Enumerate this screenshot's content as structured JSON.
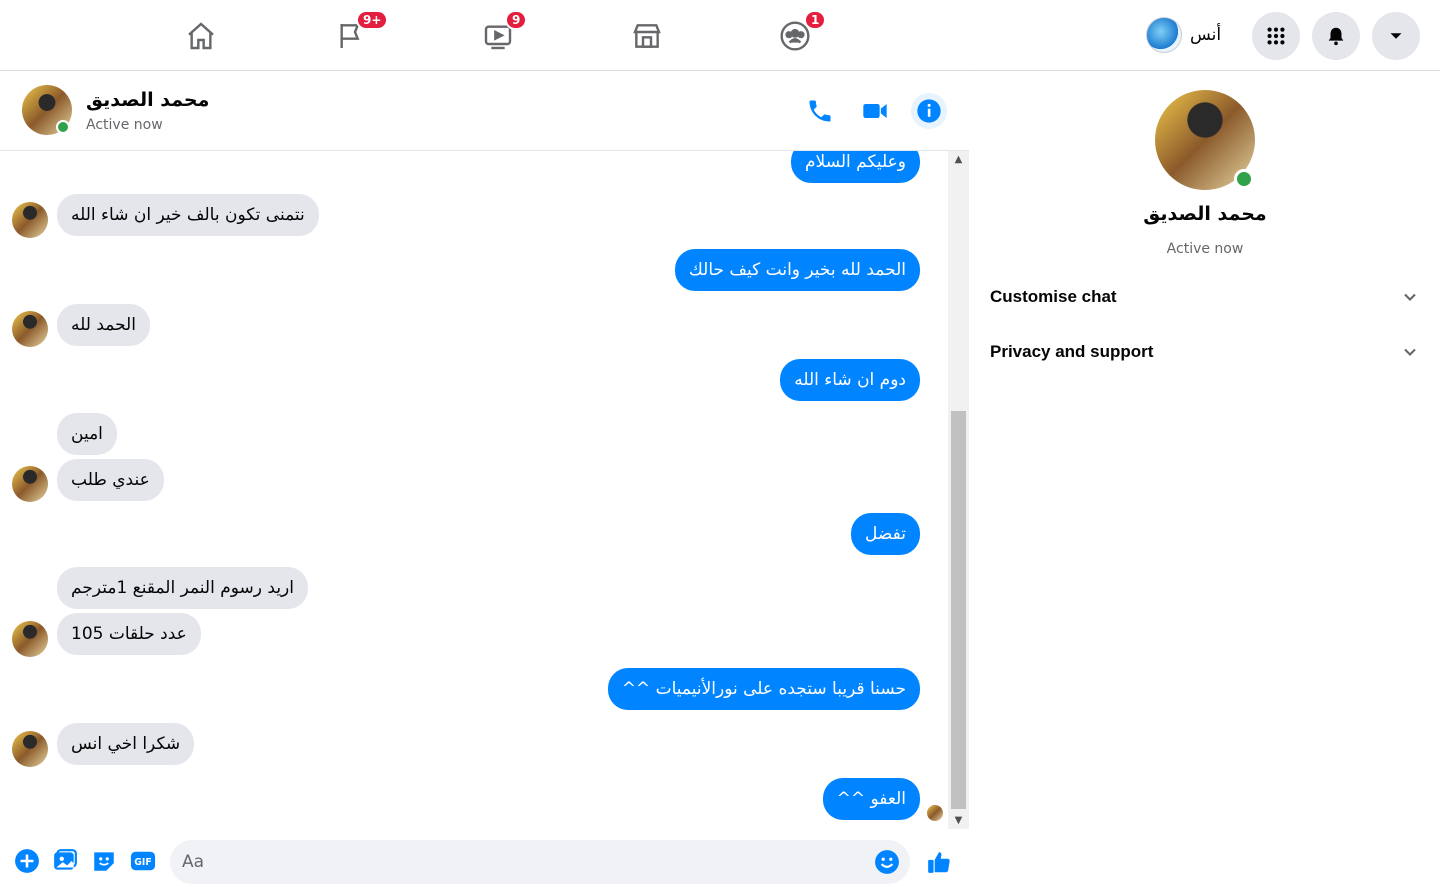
{
  "nav": {
    "tabs": [
      {
        "name": "home",
        "badge": ""
      },
      {
        "name": "pages",
        "badge": "9+"
      },
      {
        "name": "watch",
        "badge": "9"
      },
      {
        "name": "marketplace",
        "badge": ""
      },
      {
        "name": "groups",
        "badge": "1"
      }
    ],
    "profile_name": "أنس"
  },
  "chat": {
    "contact_name": "محمد الصديق",
    "status": "Active now",
    "messages": [
      {
        "dir": "out",
        "text": "وعليكم السلام"
      },
      {
        "dir": "in",
        "text": "نتمنى تكون بالف خير ان شاء الله"
      },
      {
        "dir": "out",
        "text": "الحمد لله بخير وانت كيف حالك"
      },
      {
        "dir": "in",
        "text": "الحمد لله"
      },
      {
        "dir": "out",
        "text": "دوم ان شاء الله"
      },
      {
        "dir": "in",
        "text": "امين"
      },
      {
        "dir": "in",
        "text": "عندي طلب"
      },
      {
        "dir": "out",
        "text": "تفضل"
      },
      {
        "dir": "in",
        "text": "اريد رسوم النمر المقنع 1مترجم"
      },
      {
        "dir": "in",
        "text": "عدد حلقات 105"
      },
      {
        "dir": "out",
        "text": "حسنا قريبا ستجده على نورالأنيميات ^^"
      },
      {
        "dir": "in",
        "text": "شكرا اخي انس"
      },
      {
        "dir": "out",
        "text": "العفو ^^"
      }
    ]
  },
  "composer": {
    "placeholder": "Aa",
    "gif_label": "GIF"
  },
  "right_panel": {
    "name": "محمد الصديق",
    "status": "Active now",
    "sections": [
      "Customise chat",
      "Privacy and support"
    ]
  },
  "colors": {
    "accent": "#0084ff",
    "incoming_bubble": "#e4e6eb",
    "online": "#31a24c",
    "badge": "#e41e3f"
  }
}
